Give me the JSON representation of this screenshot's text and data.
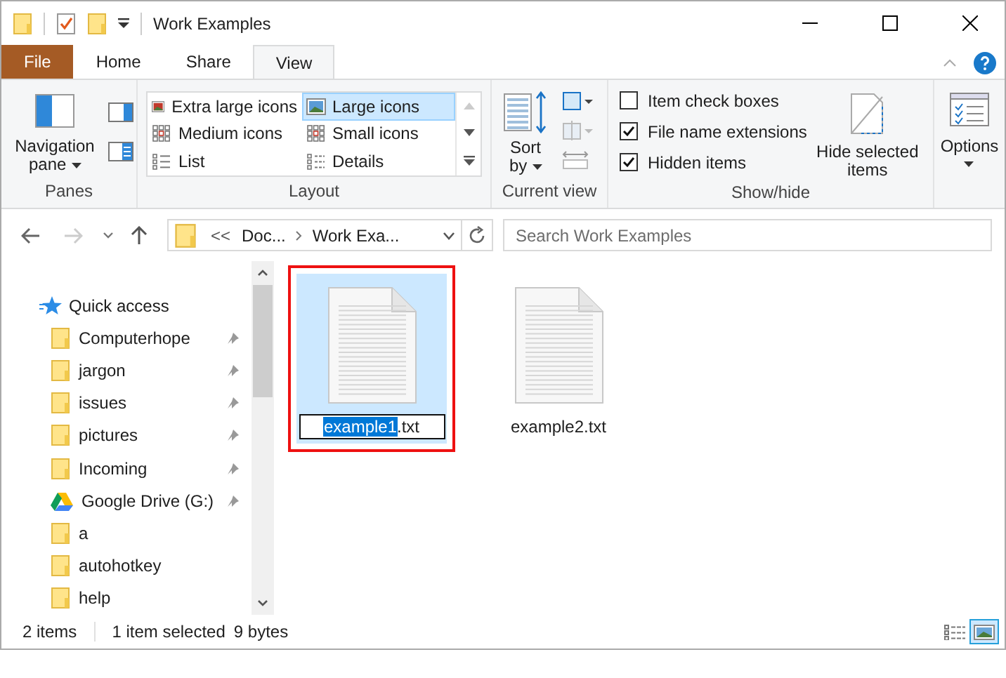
{
  "window": {
    "title": "Work Examples"
  },
  "tabs": [
    {
      "label": "File",
      "kind": "file",
      "selected": false
    },
    {
      "label": "Home",
      "kind": "tab",
      "selected": false
    },
    {
      "label": "Share",
      "kind": "tab",
      "selected": false
    },
    {
      "label": "View",
      "kind": "tab",
      "selected": true
    }
  ],
  "ribbon": {
    "panes": {
      "navigation_pane": "Navigation pane",
      "label": "Panes"
    },
    "layout": {
      "label": "Layout",
      "options": [
        {
          "label": "Extra large icons",
          "selected": false
        },
        {
          "label": "Large icons",
          "selected": true
        },
        {
          "label": "Medium icons",
          "selected": false
        },
        {
          "label": "Small icons",
          "selected": false
        },
        {
          "label": "List",
          "selected": false
        },
        {
          "label": "Details",
          "selected": false
        }
      ]
    },
    "current_view": {
      "sort_by": "Sort by",
      "label": "Current view"
    },
    "show_hide": {
      "label": "Show/hide",
      "checkboxes": [
        {
          "label": "Item check boxes",
          "checked": false
        },
        {
          "label": "File name extensions",
          "checked": true
        },
        {
          "label": "Hidden items",
          "checked": true
        }
      ],
      "hide_selected": "Hide selected items"
    },
    "options": {
      "label": "Options"
    }
  },
  "address": {
    "separator": "<<",
    "parts": [
      "Doc...",
      "Work Exa..."
    ]
  },
  "search": {
    "placeholder": "Search Work Examples"
  },
  "sidebar": {
    "quick_access": "Quick access",
    "items": [
      {
        "label": "Computerhope",
        "kind": "folder",
        "pinned": true
      },
      {
        "label": "jargon",
        "kind": "folder",
        "pinned": true
      },
      {
        "label": "issues",
        "kind": "folder",
        "pinned": true
      },
      {
        "label": "pictures",
        "kind": "folder",
        "pinned": true
      },
      {
        "label": "Incoming",
        "kind": "folder",
        "pinned": true
      },
      {
        "label": "Google Drive (G:)",
        "kind": "drive",
        "pinned": true
      },
      {
        "label": "a",
        "kind": "folder",
        "pinned": false
      },
      {
        "label": "autohotkey",
        "kind": "folder",
        "pinned": false
      },
      {
        "label": "help",
        "kind": "folder",
        "pinned": false
      }
    ]
  },
  "files": [
    {
      "kind": "rename",
      "selected": true,
      "highlighted": true,
      "name_selected": "example1",
      "name_rest": ".txt"
    },
    {
      "kind": "file",
      "selected": false,
      "highlighted": false,
      "name": "example2.txt"
    }
  ],
  "status_bar": {
    "items": "2 items",
    "selection": "1 item selected",
    "size": "9 bytes",
    "views": [
      {
        "kind": "details",
        "selected": false
      },
      {
        "kind": "large_icons",
        "selected": true
      }
    ]
  }
}
